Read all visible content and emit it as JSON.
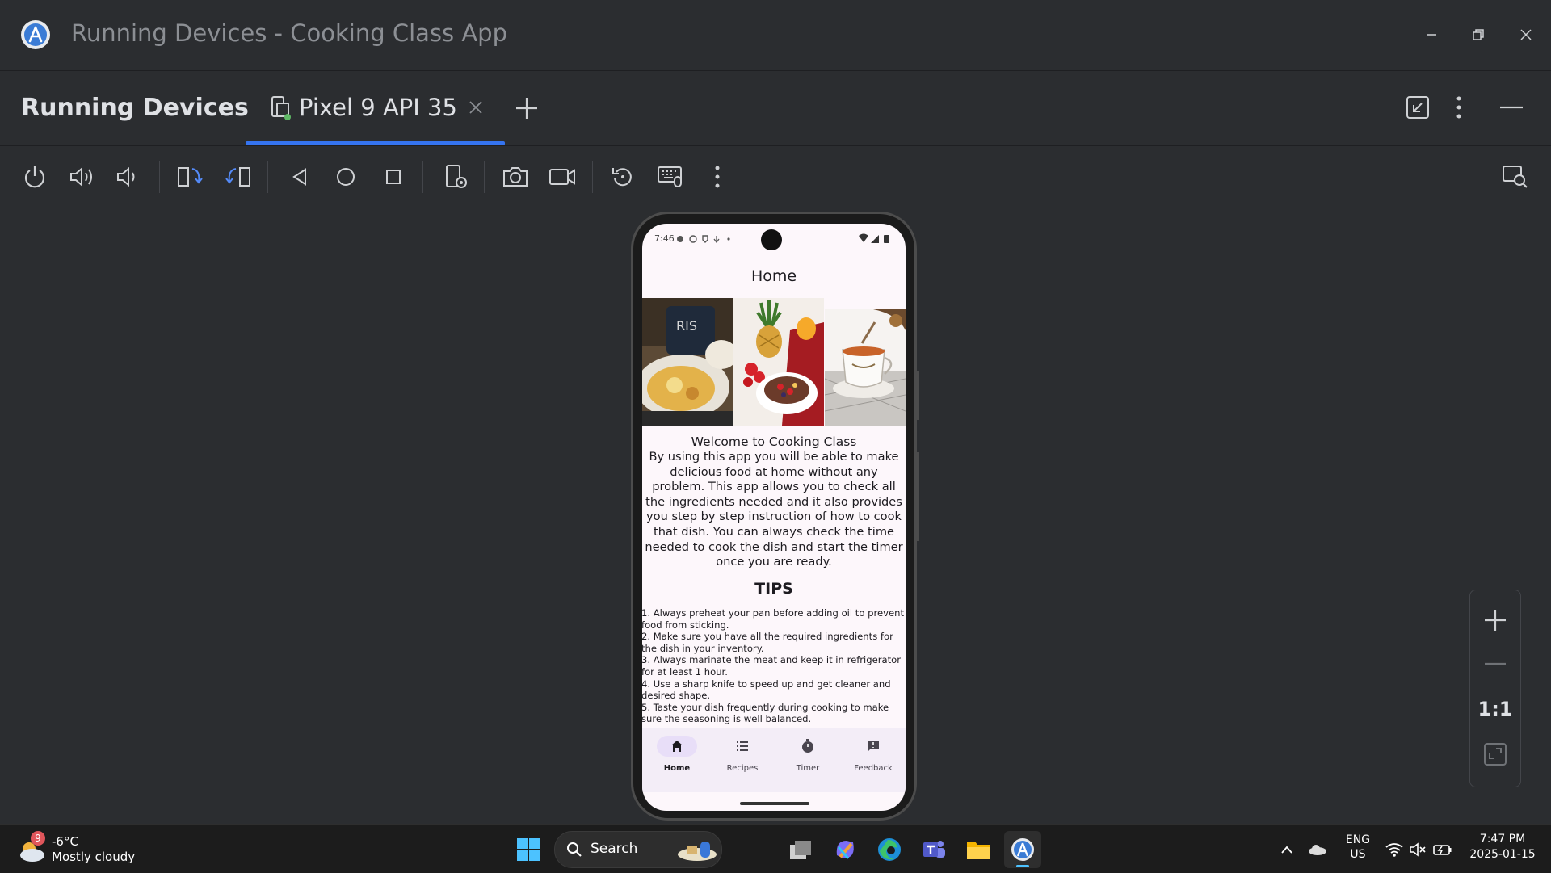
{
  "window": {
    "title": "Running Devices - Cooking Class App",
    "controls": [
      "minimize-icon",
      "restore-icon",
      "close-icon"
    ]
  },
  "tabs_row": {
    "panel_title": "Running Devices",
    "device_tab": {
      "label": "Pixel 9 API 35",
      "icon": "device-status-icon",
      "close_icon": "close-icon"
    },
    "add_tab_icon": "plus-icon",
    "right_icons": [
      "minimize-to-corner-icon",
      "more-options-icon",
      "hide-panel-icon"
    ]
  },
  "toolbar": {
    "icons": [
      "power-icon",
      "volume-up-icon",
      "volume-down-icon",
      "rotate-left-icon",
      "rotate-right-icon",
      "back-icon",
      "home-icon",
      "overview-icon",
      "device-settings-icon",
      "screenshot-icon",
      "screen-record-icon",
      "reset-icon",
      "keyboard-icon",
      "more-icon",
      "inspect-layout-icon"
    ]
  },
  "phone": {
    "status_time": "7:46",
    "screen_title": "Home",
    "welcome_title": "Welcome to Cooking Class",
    "welcome_body": "By using this app you will be able to make delicious food at home without any problem. This app allows you to check all the ingredients needed and it also provides you step by step instruction of how to cook that dish. You can always check the time needed to cook the dish and start the timer once you are ready.",
    "tips_title": "TIPS",
    "tips": [
      "1. Always preheat your pan before adding oil to prevent food from sticking.",
      " 2. Make sure you have all the required ingredients for the dish in your inventory.",
      " 3. Always marinate the meat and keep it in refrigerator for at least 1 hour.",
      " 4. Use a sharp knife to speed up and get cleaner and desired shape.",
      " 5. Taste your dish frequently during cooking to make sure the seasoning is well balanced."
    ],
    "nav": [
      {
        "label": "Home",
        "icon": "home-icon",
        "selected": true
      },
      {
        "label": "Recipes",
        "icon": "list-icon",
        "selected": false
      },
      {
        "label": "Timer",
        "icon": "timer-icon",
        "selected": false
      },
      {
        "label": "Feedback",
        "icon": "feedback-icon",
        "selected": false
      }
    ]
  },
  "zoom": {
    "ratio_label": "1:1"
  },
  "taskbar": {
    "weather": {
      "badge": "9",
      "temp": "-6°C",
      "desc": "Mostly cloudy"
    },
    "search_placeholder": "Search",
    "language": {
      "line1": "ENG",
      "line2": "US"
    },
    "time": "7:47 PM",
    "date": "2025-01-15"
  },
  "colors": {
    "accent": "#3574f0",
    "ide_bg": "#2b2d30",
    "app_bg": "#fdf7fb",
    "nav_bg": "#f3edf7",
    "nav_selected": "#e8def8"
  }
}
